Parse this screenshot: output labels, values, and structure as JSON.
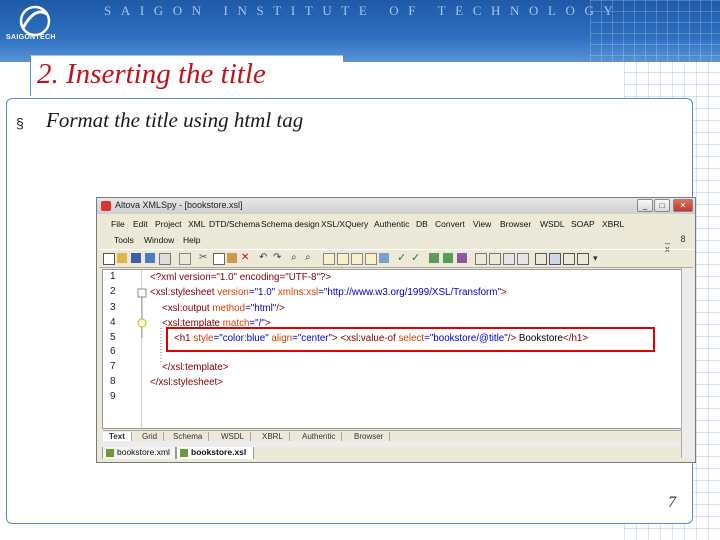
{
  "header": {
    "logo_text": "SAIGONTECH",
    "institute": "SAIGON INSTITUTE OF TECHNOLOGY"
  },
  "slide": {
    "title": "2. Inserting the title",
    "bullet_symbol": "§",
    "bullet_text": "Format the title using html tag",
    "page_number": "7"
  },
  "app": {
    "window_title": "Altova XMLSpy - [bookstore.xsl]",
    "menu_row1": [
      "File",
      "Edit",
      "Project",
      "XML",
      "DTD/Schema",
      "Schema design",
      "XSL/XQuery",
      "Authentic",
      "DB",
      "Convert",
      "View",
      "Browser",
      "WSDL",
      "SOAP",
      "XBRL"
    ],
    "menu_row2": [
      "Tools",
      "Window",
      "Help"
    ],
    "mdi_controls": "_ 8 x",
    "line_numbers": [
      "1",
      "2",
      "3",
      "4",
      "5",
      "6",
      "7",
      "8",
      "9"
    ],
    "code": {
      "l1": "<?xml version=\"1.0\" encoding=\"UTF-8\"?>",
      "l2_tag": "<xsl:stylesheet",
      "l2_a1": "version",
      "l2_v1": "=\"1.0\"",
      "l2_a2": "xmlns:xsl",
      "l2_v2": "=\"http://www.w3.org/1999/XSL/Transform\"",
      "l2_end": ">",
      "l3_tag": "<xsl:output",
      "l3_a1": "method",
      "l3_v1": "=\"html\"",
      "l3_end": "/>",
      "l4_tag": "<xsl:template",
      "l4_a1": "match",
      "l4_v1": "=\"/\"",
      "l4_end": ">",
      "l5_tag1": "<h1",
      "l5_a1": "style",
      "l5_v1": "=\"color:blue\"",
      "l5_a2": "align",
      "l5_v2": "=\"center\"",
      "l5_end1": ">",
      "l5_tag2": "<xsl:value-of",
      "l5_a3": "select",
      "l5_v3": "=\"bookstore/@title\"",
      "l5_end2": "/>",
      "l5_text": " Bookstore",
      "l5_close": "</h1>",
      "l7": "</xsl:template>",
      "l8": "</xsl:stylesheet>"
    },
    "view_tabs": [
      "Text",
      "Grid",
      "Schema",
      "WSDL",
      "XBRL",
      "Authentic",
      "Browser"
    ],
    "doc_tabs": [
      "bookstore.xml",
      "bookstore.xsl"
    ]
  },
  "colors": {
    "title_red": "#c0121b",
    "header_blue": "#2d6fc0",
    "highlight_red": "#e00000"
  }
}
